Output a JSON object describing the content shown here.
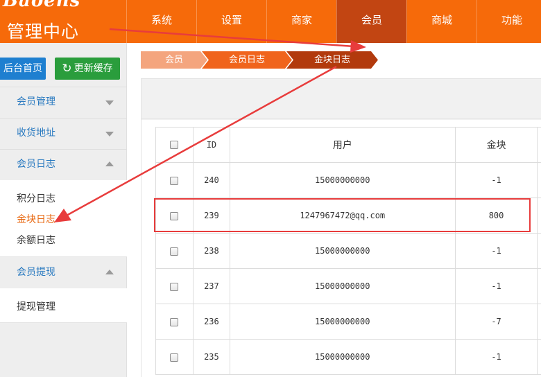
{
  "app": {
    "brand": "Baoens",
    "title": "管理中心"
  },
  "nav": {
    "items": [
      {
        "label": "系统"
      },
      {
        "label": "设置"
      },
      {
        "label": "商家"
      },
      {
        "label": "会员",
        "active": true
      },
      {
        "label": "商城"
      },
      {
        "label": "功能"
      }
    ]
  },
  "sidebar": {
    "home_button": "后台首页",
    "refresh_button": "更新缓存",
    "sections": [
      {
        "label": "会员管理",
        "expanded": false
      },
      {
        "label": "收货地址",
        "expanded": false
      },
      {
        "label": "会员日志",
        "expanded": true,
        "items": [
          "积分日志",
          "金块日志",
          "余额日志"
        ],
        "active_item": "金块日志"
      },
      {
        "label": "会员提现",
        "expanded": true,
        "items": [
          "提现管理"
        ]
      }
    ]
  },
  "breadcrumb": [
    "会员",
    "会员日志",
    "金块日志"
  ],
  "table": {
    "headers": [
      "",
      "ID",
      "用户",
      "金块"
    ],
    "rows": [
      {
        "id": "240",
        "user": "15000000000",
        "gold": "-1"
      },
      {
        "id": "239",
        "user": "1247967472@qq.com",
        "gold": "800",
        "highlighted": true
      },
      {
        "id": "238",
        "user": "15000000000",
        "gold": "-1"
      },
      {
        "id": "237",
        "user": "15000000000",
        "gold": "-1"
      },
      {
        "id": "236",
        "user": "15000000000",
        "gold": "-7"
      },
      {
        "id": "235",
        "user": "15000000000",
        "gold": "-1"
      }
    ]
  },
  "colors": {
    "header": "#f66a0a",
    "nav_active": "#c24512",
    "crumb_1": "#f4a57e",
    "crumb_2": "#f0641c",
    "crumb_3": "#b23a0d",
    "annotation": "#e83c3c",
    "active_link": "#e8660e"
  }
}
